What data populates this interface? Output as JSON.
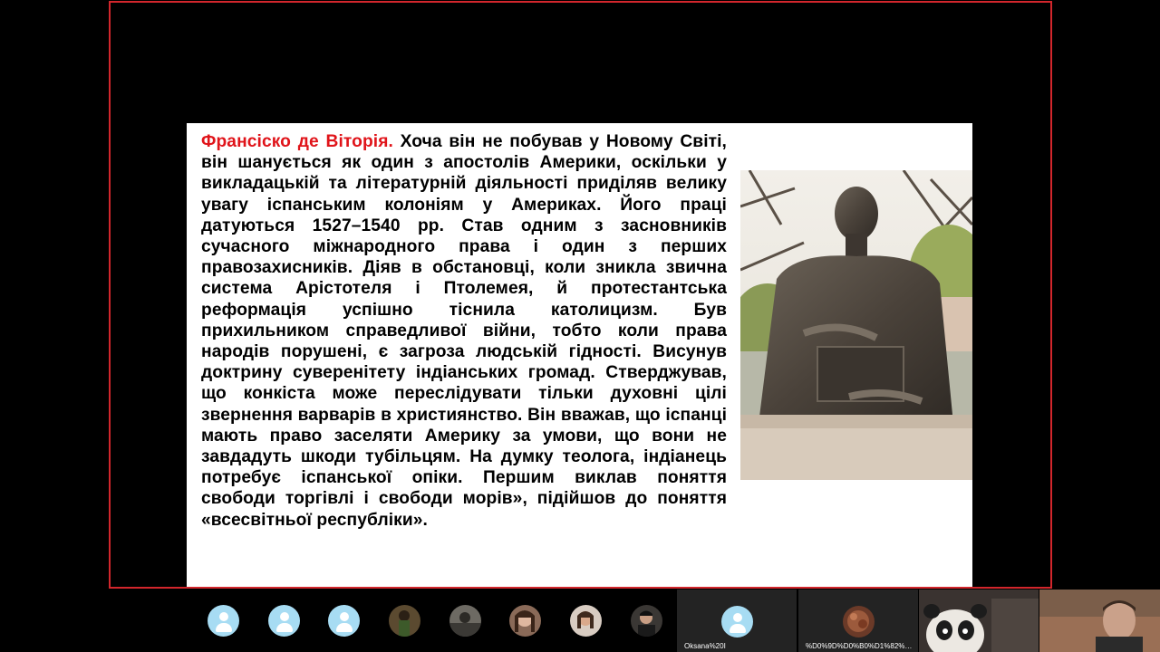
{
  "slide": {
    "heading_name": "Франсіско де Віторія.",
    "body": " Хоча він не побував у Новому Світі, він шанується як один з апостолів Америки, оскільки у викладацькій та літературній діяльності приділяв велику увагу іспанським колоніям у Америках. Його праці датуються 1527–1540 рр. Став одним з засновників сучасного міжнародного права і один з перших правозахисників. Діяв в обстановці, коли зникла звична система Арістотеля і Птолемея, й протестантська реформація успішно тіснила католицизм. Був прихильником справедливої війни, тобто коли права народів порушені, є загроза людській гідності. Висунув доктрину суверенітету індіанських громад. Стверджував, що конкіста може переслідувати тільки духовні цілі звернення варварів в християнство. Він вважав, що іспанці мають право заселяти Америку за умови, що вони не завдадуть шкоди тубільцям. На думку теолога, індіанець потребує іспанської опіки. Першим виклав поняття свободи торгівлі і свободи морів», підійшов до поняття «всесвітньої республіки».",
    "photo_subject": "bronze bust statue"
  },
  "participants": [
    {
      "type": "default"
    },
    {
      "type": "default"
    },
    {
      "type": "default"
    },
    {
      "type": "photo",
      "tone": "#5b4a30"
    },
    {
      "type": "photo",
      "tone": "#6d6a63"
    },
    {
      "type": "photo",
      "tone": "#8a6a58"
    },
    {
      "type": "photo",
      "tone": "#7d6656"
    },
    {
      "type": "photo",
      "tone": "#3a3734"
    }
  ],
  "video_tiles": {
    "oksana": {
      "name": "Oksana%20I"
    },
    "encoded": {
      "name": "%D0%9D%D0%B0%D1%82%D0%B..."
    }
  },
  "colors": {
    "frame_border": "#d2262c",
    "heading_red": "#e0141a",
    "avatar_blue": "#a7dcf3"
  }
}
